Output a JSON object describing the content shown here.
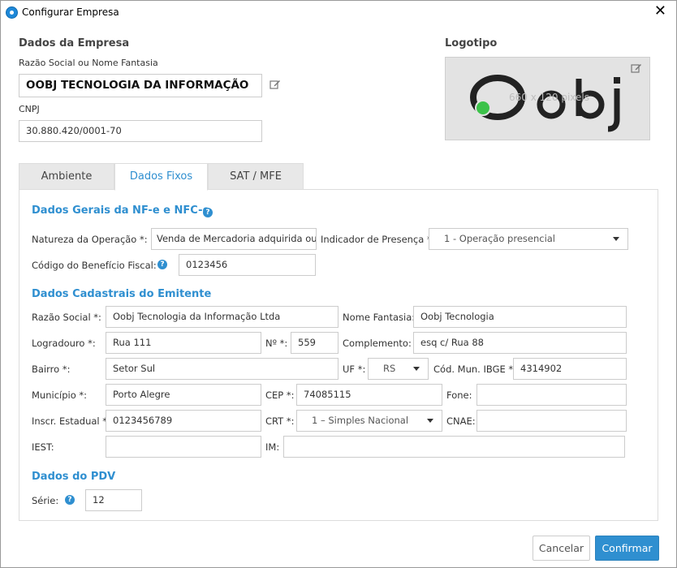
{
  "window": {
    "title": "Configurar Empresa",
    "close": "✕"
  },
  "empresa": {
    "section_title": "Dados da Empresa",
    "razao_label": "Razão Social ou Nome Fantasia",
    "razao_value": "OOBJ TECNOLOGIA DA INFORMAÇÃO",
    "cnpj_label": "CNPJ",
    "cnpj_value": "30.880.420/0001-70"
  },
  "logotipo": {
    "section_title": "Logotipo",
    "logo_text": "Oobj",
    "dims_text": "660 x 120 pixels"
  },
  "tabs": [
    {
      "label": "Ambiente",
      "active": false
    },
    {
      "label": "Dados Fixos",
      "active": true
    },
    {
      "label": "SAT / MFE",
      "active": false
    }
  ],
  "nfe": {
    "title": "Dados Gerais da NF-e e NFC-e",
    "natureza_label": "Natureza da Operação *:",
    "natureza_value": "Venda de Mercadoria adquirida ou",
    "presenca_label": "Indicador de Presença *:",
    "presenca_value": "1 - Operação presencial",
    "beneficio_label": "Código do Benefício Fiscal:",
    "beneficio_value": "0123456"
  },
  "emitente": {
    "title": "Dados Cadastrais do Emitente",
    "razao_label": "Razão Social *:",
    "razao_value": "Oobj Tecnologia da Informação Ltda",
    "fantasia_label": "Nome Fantasia:",
    "fantasia_value": "Oobj Tecnologia",
    "logradouro_label": "Logradouro *:",
    "logradouro_value": "Rua 111",
    "numero_label": "Nº *:",
    "numero_value": "559",
    "complemento_label": "Complemento:",
    "complemento_value": "esq c/ Rua 88",
    "bairro_label": "Bairro *:",
    "bairro_value": "Setor Sul",
    "uf_label": "UF *:",
    "uf_value": "RS",
    "ibge_label": "Cód. Mun. IBGE *:",
    "ibge_value": "4314902",
    "municipio_label": "Município *:",
    "municipio_value": "Porto Alegre",
    "cep_label": "CEP *:",
    "cep_value": "74085115",
    "fone_label": "Fone:",
    "fone_value": "",
    "ie_label": "Inscr. Estadual *:",
    "ie_value": "0123456789",
    "crt_label": "CRT *:",
    "crt_value": "1 – Simples Nacional",
    "cnae_label": "CNAE:",
    "cnae_value": "",
    "iest_label": "IEST:",
    "iest_value": "",
    "im_label": "IM:",
    "im_value": ""
  },
  "pdv": {
    "title": "Dados do PDV",
    "serie_label": "Série:",
    "serie_value": "12"
  },
  "buttons": {
    "cancel": "Cancelar",
    "confirm": "Confirmar"
  },
  "colors": {
    "accent": "#2f8fd0",
    "logo_green": "#3cc24a"
  },
  "icons": {
    "help": "?",
    "edit": "pencil-square-icon"
  }
}
